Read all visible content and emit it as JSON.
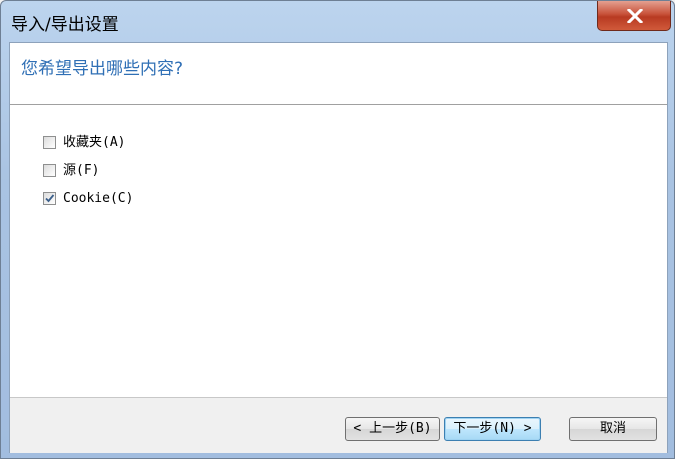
{
  "window": {
    "title": "导入/导出设置",
    "close_icon": "close-icon"
  },
  "header": {
    "question": "您希望导出哪些内容?"
  },
  "options": [
    {
      "label": "收藏夹(A)",
      "checked": false
    },
    {
      "label": "源(F)",
      "checked": false
    },
    {
      "label": "Cookie(C)",
      "checked": true
    }
  ],
  "footer": {
    "back_label": "< 上一步(B)",
    "next_label": "下一步(N) >",
    "cancel_label": "取消"
  }
}
